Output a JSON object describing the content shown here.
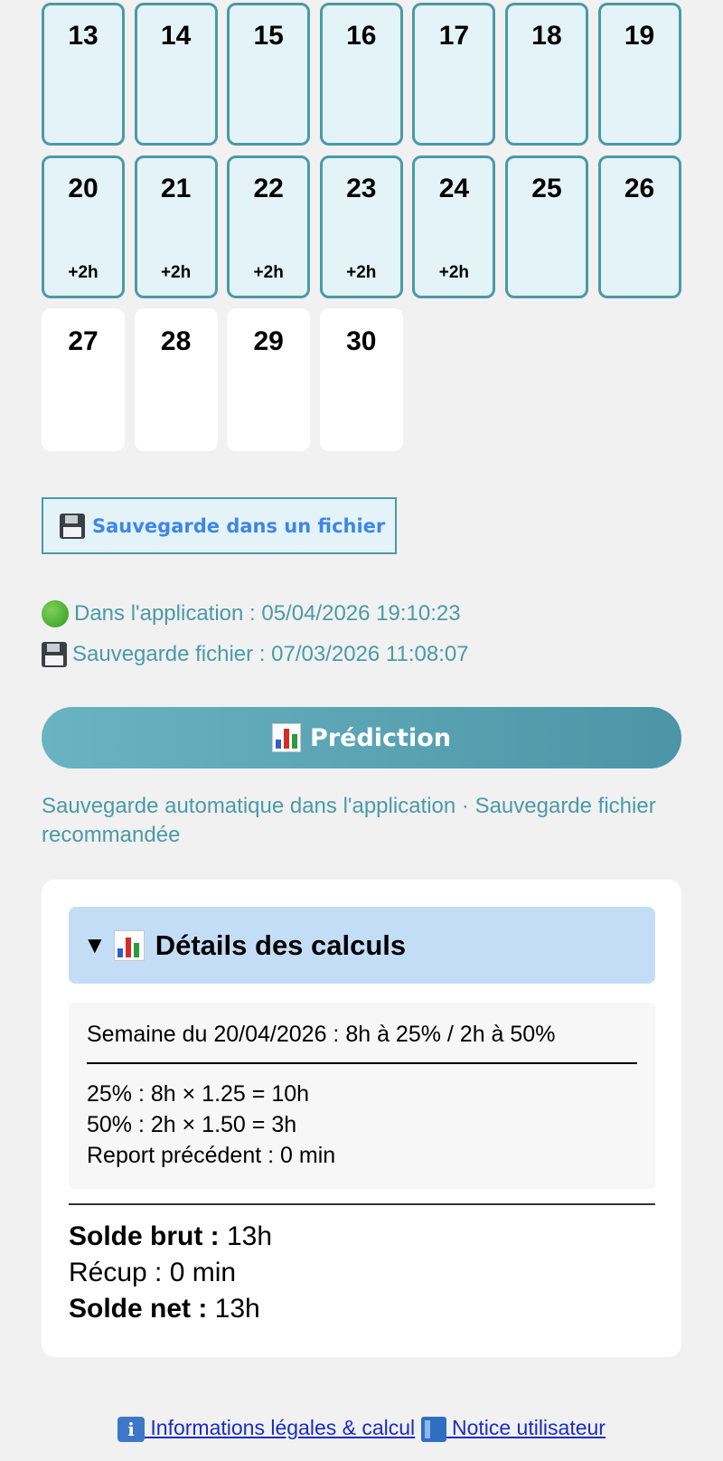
{
  "calendar": {
    "days": [
      {
        "num": "13",
        "extra": "",
        "active": true
      },
      {
        "num": "14",
        "extra": "",
        "active": true
      },
      {
        "num": "15",
        "extra": "",
        "active": true
      },
      {
        "num": "16",
        "extra": "",
        "active": true
      },
      {
        "num": "17",
        "extra": "",
        "active": true
      },
      {
        "num": "18",
        "extra": "",
        "active": true
      },
      {
        "num": "19",
        "extra": "",
        "active": true
      },
      {
        "num": "20",
        "extra": "+2h",
        "active": true
      },
      {
        "num": "21",
        "extra": "+2h",
        "active": true
      },
      {
        "num": "22",
        "extra": "+2h",
        "active": true
      },
      {
        "num": "23",
        "extra": "+2h",
        "active": true
      },
      {
        "num": "24",
        "extra": "+2h",
        "active": true
      },
      {
        "num": "25",
        "extra": "",
        "active": true
      },
      {
        "num": "26",
        "extra": "",
        "active": true
      },
      {
        "num": "27",
        "extra": "",
        "active": false
      },
      {
        "num": "28",
        "extra": "",
        "active": false
      },
      {
        "num": "29",
        "extra": "",
        "active": false
      },
      {
        "num": "30",
        "extra": "",
        "active": false
      }
    ]
  },
  "save_button": {
    "label": "Sauvegarde dans un fichier",
    "icon": "floppy-disk-icon"
  },
  "status": {
    "app_label": "Dans l'application : 05/04/2026 19:10:23",
    "file_label": "Sauvegarde fichier : 07/03/2026 11:08:07"
  },
  "prediction_button": {
    "label": "Prédiction",
    "icon": "bar-chart-icon"
  },
  "auto_note": "Sauvegarde automatique dans l'application · Sauvegarde fichier recommandée",
  "details": {
    "summary_marker": "▼",
    "title": "Détails des calculs",
    "week_line": "Semaine du 20/04/2026 : 8h à 25% / 2h à 50%",
    "calc_lines": [
      "25% : 8h × 1.25 = 10h",
      "50% : 2h × 1.50 = 3h",
      "Report précédent : 0 min"
    ],
    "solde_brut_label": "Solde brut :",
    "solde_brut_value": " 13h",
    "recup_line": "Récup : 0 min",
    "solde_net_label": "Solde net :",
    "solde_net_value": " 13h"
  },
  "footer": {
    "legal_link": " Informations légales & calcul",
    "notice_link": " Notice utilisateur",
    "info_glyph": "i"
  },
  "colors": {
    "accent": "#4a9aa8",
    "cell_bg": "#e4f3f8",
    "link": "#1b2cc2",
    "save_text": "#3e86e8",
    "summary_bg": "#c4ddf7"
  }
}
